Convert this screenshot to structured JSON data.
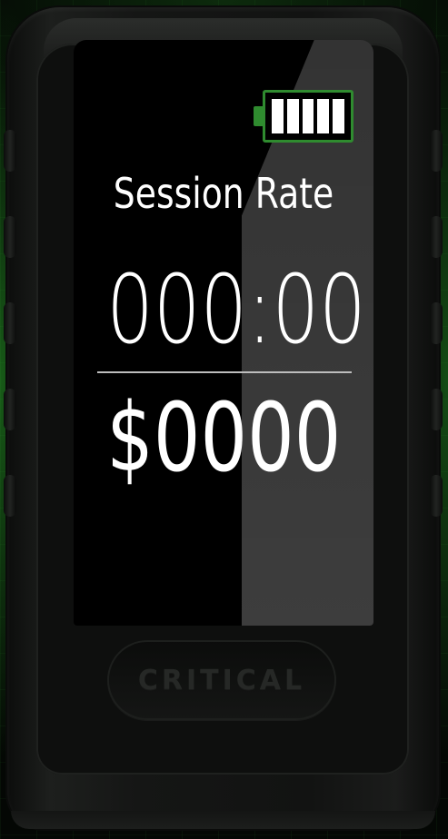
{
  "device": {
    "brand_logo": "CRITICAL",
    "battery": {
      "level_fraction": 1.0,
      "cells_filled": 5,
      "cells_total": 5,
      "frame_color": "#2f8b2f"
    },
    "screen": {
      "title": "Session Rate",
      "timer_value": "000:00",
      "rate_value": "$0000"
    }
  },
  "colors": {
    "accent_green": "#2f8b2f",
    "screen_background": "#000000",
    "text": "#ffffff"
  },
  "icons": {
    "battery": "battery-full-icon"
  }
}
